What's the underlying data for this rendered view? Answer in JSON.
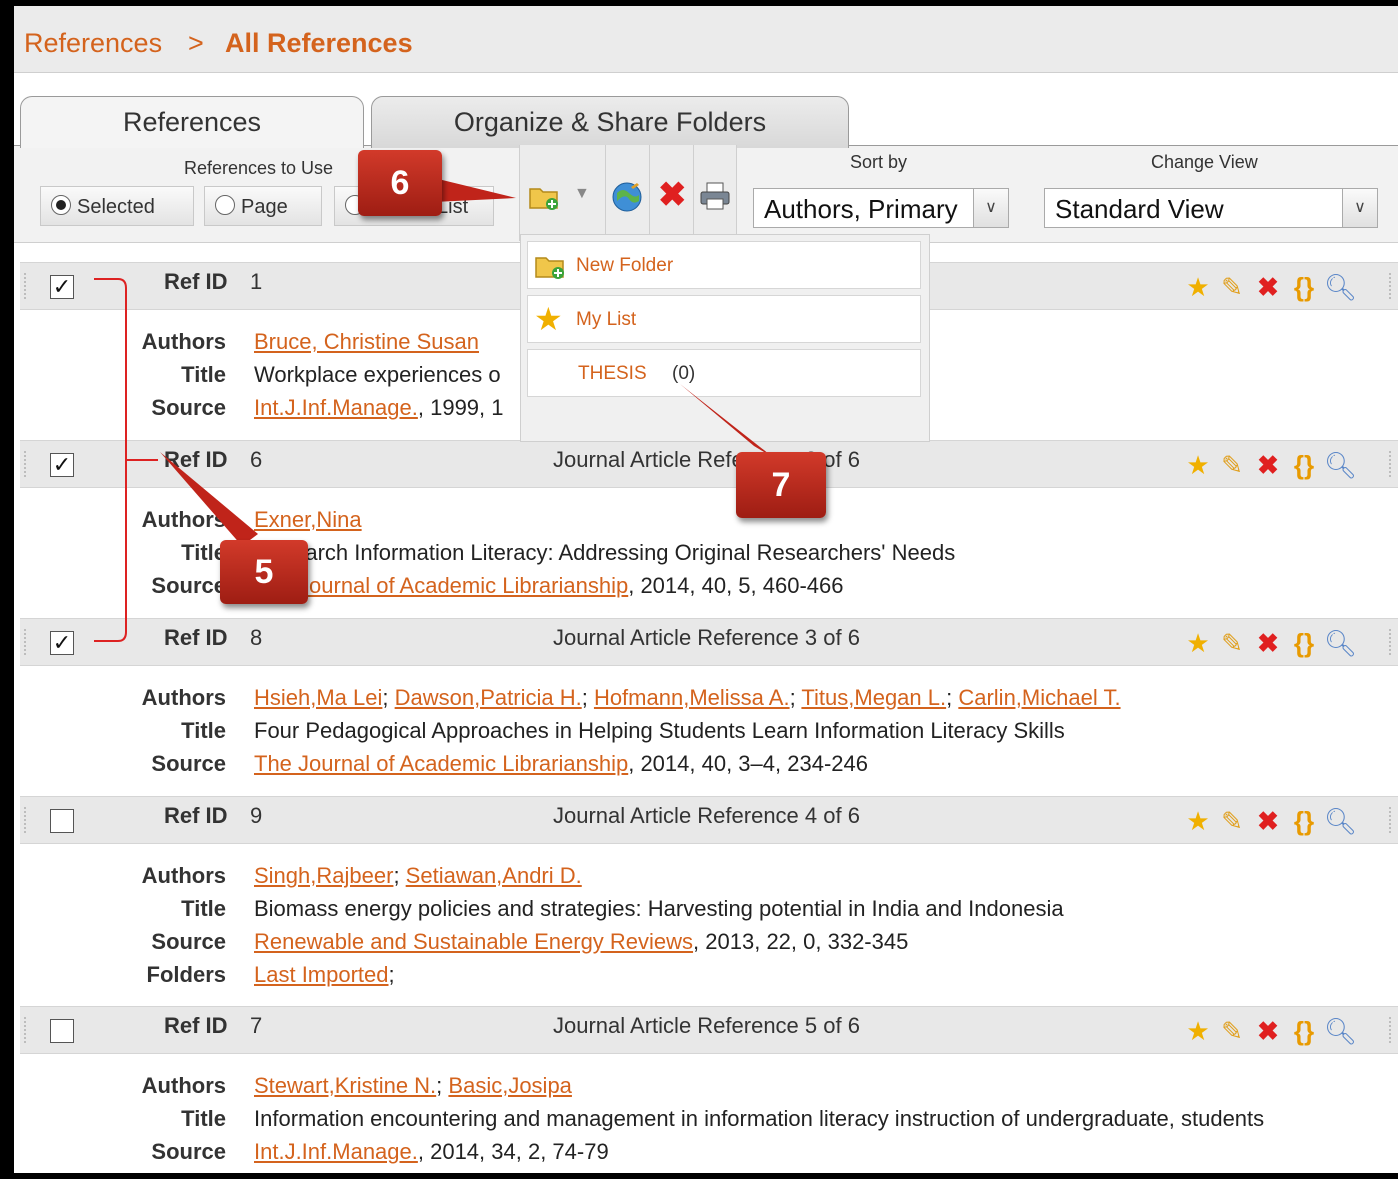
{
  "breadcrumb": {
    "root": "References",
    "sep": ">",
    "current": "All References"
  },
  "tabs": [
    {
      "label": "References"
    },
    {
      "label": "Organize & Share Folders"
    }
  ],
  "toolbar": {
    "refs_to_use_label": "References to Use",
    "radio": {
      "selected": "Selected",
      "page": "Page",
      "list": "List"
    },
    "sort_label": "Sort by",
    "sort_value": "Authors, Primary",
    "view_label": "Change View",
    "view_value": "Standard View"
  },
  "dropdown": {
    "new_folder": "New Folder",
    "my_list": "My List",
    "thesis": "THESIS",
    "thesis_count": "(0)"
  },
  "callouts": {
    "c5": "5",
    "c6": "6",
    "c7": "7"
  },
  "field_labels": {
    "authors": "Authors",
    "title": "Title",
    "source": "Source",
    "folders": "Folders",
    "refid": "Ref ID"
  },
  "references": [
    {
      "id": "1",
      "checked": true,
      "type": "",
      "authors": [
        "Bruce, Christine Susan"
      ],
      "title": "Workplace experiences o",
      "source_link": "Int.J.Inf.Manage.",
      "source_rest": ", 1999, 1"
    },
    {
      "id": "6",
      "checked": true,
      "type": "Journal Article Reference 2 of 6",
      "authors": [
        "Exner,Nina"
      ],
      "title": "Research Information Literacy: Addressing Original Researchers' Needs",
      "source_link": "The Journal of Academic Librarianship",
      "source_rest": ", 2014, 40, 5, 460-466"
    },
    {
      "id": "8",
      "checked": true,
      "type": "Journal Article Reference 3 of 6",
      "authors": [
        "Hsieh,Ma Lei",
        "Dawson,Patricia H.",
        "Hofmann,Melissa A.",
        "Titus,Megan L.",
        "Carlin,Michael T."
      ],
      "title": "Four Pedagogical Approaches in Helping Students Learn Information Literacy Skills",
      "source_link": "The Journal of Academic Librarianship",
      "source_rest": ", 2014, 40, 3–4, 234-246"
    },
    {
      "id": "9",
      "checked": false,
      "type": "Journal Article Reference 4 of 6",
      "authors": [
        "Singh,Rajbeer",
        "Setiawan,Andri D."
      ],
      "title": "Biomass energy policies and strategies: Harvesting potential in India and Indonesia",
      "source_link": "Renewable and Sustainable Energy Reviews",
      "source_rest": ", 2013, 22, 0, 332-345",
      "folders_link": "Last Imported",
      "folders_rest": ";"
    },
    {
      "id": "7",
      "checked": false,
      "type": "Journal Article Reference 5 of 6",
      "authors": [
        "Stewart,Kristine N.",
        "Basic,Josipa"
      ],
      "title": "Information encountering and management in information literacy instruction of undergraduate, students",
      "source_link": "Int.J.Inf.Manage.",
      "source_rest": ", 2014, 34, 2, 74-79"
    }
  ]
}
